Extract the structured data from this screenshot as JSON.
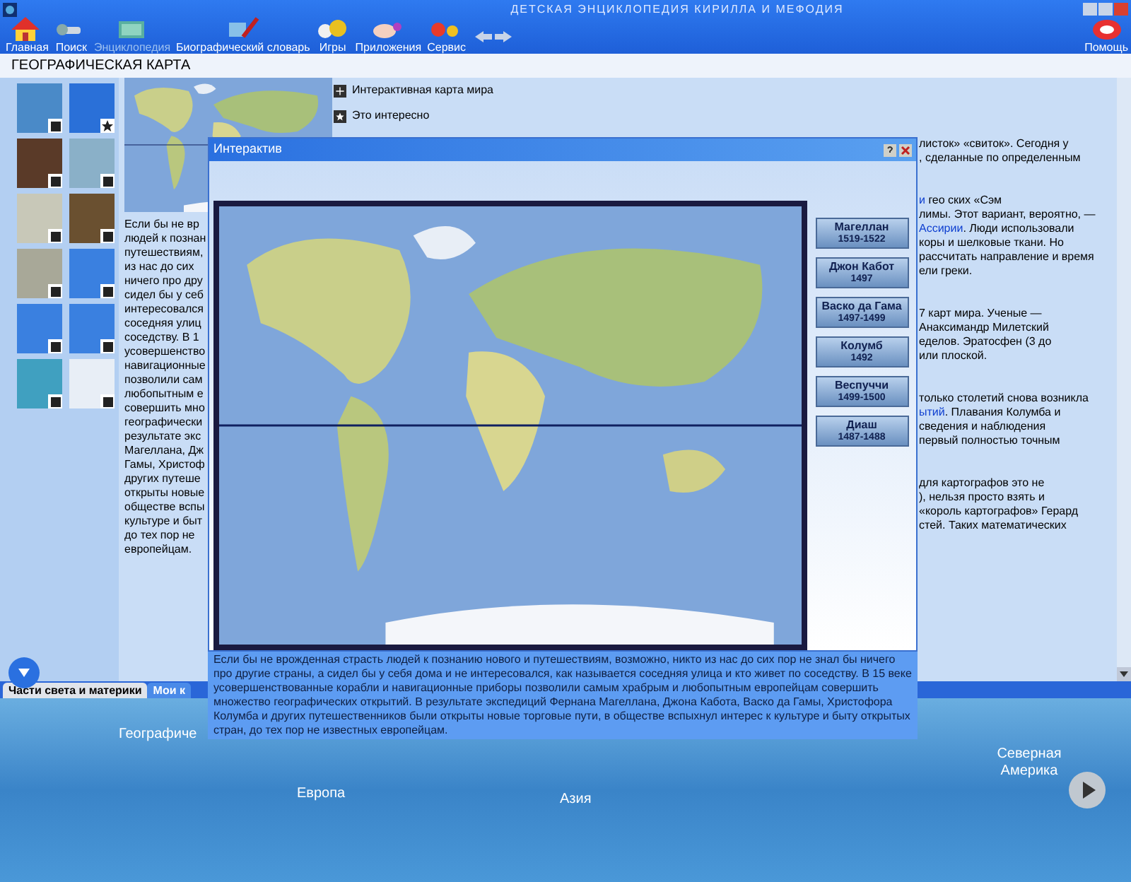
{
  "window": {
    "title": "ДЕТСКАЯ ЭНЦИКЛОПЕДИЯ КИРИЛЛА И МЕФОДИЯ"
  },
  "nav": [
    {
      "label": "Главная",
      "selected": false,
      "kind": "home"
    },
    {
      "label": "Поиск",
      "selected": false,
      "kind": "search"
    },
    {
      "label": "Энциклопедия",
      "selected": true,
      "kind": "book"
    },
    {
      "label": "Биографический словарь",
      "selected": false,
      "kind": "pen"
    },
    {
      "label": "Игры",
      "selected": false,
      "kind": "game"
    },
    {
      "label": "Приложения",
      "selected": false,
      "kind": "app"
    },
    {
      "label": "Сервис",
      "selected": false,
      "kind": "service"
    }
  ],
  "help": {
    "label": "Помощь"
  },
  "section_title": "ГЕОГРАФИЧЕСКАЯ КАРТА",
  "thumbnails": [
    {
      "kind": "frame"
    },
    {
      "kind": "star"
    },
    {
      "kind": "frame"
    },
    {
      "kind": "frame"
    },
    {
      "kind": "frame"
    },
    {
      "kind": "frame"
    },
    {
      "kind": "frame"
    },
    {
      "kind": "frame"
    },
    {
      "kind": "frame"
    },
    {
      "kind": "frame"
    },
    {
      "kind": "frame"
    },
    {
      "kind": "frame"
    }
  ],
  "links": [
    {
      "label": "Интерактивная карта мира",
      "kind": "map"
    },
    {
      "label": "Это интересно",
      "kind": "star"
    }
  ],
  "article_left": [
    "Если бы не вр",
    "людей к познан",
    "путешествиям,",
    "из нас до сих",
    "ничего про дру",
    "сидел бы у себ",
    "интересовался",
    "соседняя улиц",
    "соседству. В 1",
    "усовершенство",
    "навигационные",
    "позволили сам",
    "любопытным е",
    "совершить мно",
    "географически",
    "результате экс",
    "Магеллана, Дж",
    "Гамы, Христоф",
    "других путеше",
    "открыты новые",
    "обществе вспы",
    "культуре и быт",
    "до тех пор не",
    "европейцам."
  ],
  "article_right": [
    {
      "lines": [
        [
          {
            "text": "листок» «свиток». Сегодня у",
            "link": false
          }
        ],
        [
          {
            "text": ", сделанные по определенным",
            "link": false
          }
        ]
      ]
    },
    {
      "lines": [
        [
          {
            "text": "и",
            "link": true
          },
          {
            "text": " гео ских «Сэм",
            "link": false
          }
        ],
        [
          {
            "text": "лимы. Этот вариант, вероятно, —",
            "link": false
          }
        ],
        [
          {
            "text": "Ассирии",
            "link": true
          },
          {
            "text": ". Люди использовали",
            "link": false
          }
        ],
        [
          {
            "text": "коры и шелковые ткани. Но",
            "link": false
          }
        ],
        [
          {
            "text": "рассчитать направление и время",
            "link": false
          }
        ],
        [
          {
            "text": "ели греки.",
            "link": false
          }
        ]
      ]
    },
    {
      "lines": [
        [
          {
            "text": "7 карт мира. Ученые —",
            "link": false
          }
        ],
        [
          {
            "text": "Анаксимандр Милетский",
            "link": false
          }
        ],
        [
          {
            "text": "еделов. Эратосфен (3 до",
            "link": false
          }
        ],
        [
          {
            "text": "или плоской.",
            "link": false
          }
        ]
      ]
    },
    {
      "lines": [
        [
          {
            "text": "только столетий снова возникла",
            "link": false
          }
        ],
        [
          {
            "text": "ытий",
            "link": true
          },
          {
            "text": ". Плавания Колумба и",
            "link": false
          }
        ],
        [
          {
            "text": "сведения и наблюдения",
            "link": false
          }
        ],
        [
          {
            "text": "первый полностью точным",
            "link": false
          }
        ]
      ]
    },
    {
      "lines": [
        [
          {
            "text": "для картографов это не",
            "link": false
          }
        ],
        [
          {
            "text": "), нельзя просто взять и",
            "link": false
          }
        ],
        [
          {
            "text": "«король картографов» Герард",
            "link": false
          }
        ],
        [
          {
            "text": "стей. Таких математических",
            "link": false
          }
        ]
      ]
    }
  ],
  "popup": {
    "title": "Интерактив",
    "explorers": [
      {
        "name": "Магеллан",
        "years": "1519-1522"
      },
      {
        "name": "Джон Кабот",
        "years": "1497"
      },
      {
        "name": "Васко да Гама",
        "years": "1497-1499"
      },
      {
        "name": "Колумб",
        "years": "1492"
      },
      {
        "name": "Веспуччи",
        "years": "1499-1500"
      },
      {
        "name": "Диаш",
        "years": "1487-1488"
      }
    ],
    "caption": "Если бы не врожденная страсть людей к познанию нового и путешествиям, возможно, никто из нас до сих пор не знал бы ничего про другие страны, а сидел бы у себя дома и не интересовался, как называется соседняя улица и кто живет по соседству. В 15 веке усовершенствованные корабли и навигационные приборы позволили самым храбрым и любопытным европейцам совершить множество географических открытий. В результате экспедиций Фернана Магеллана, Джона Кабота, Васко да Гамы, Христофора Колумба и других путешественников были открыты новые торговые пути, в обществе вспыхнул интерес к культуре и быту открытых стран, до тех пор не известных европейцам."
  },
  "bottom_tabs": [
    {
      "label": "Части света и материки",
      "selected": true
    },
    {
      "label": "Мои к",
      "selected": false
    }
  ],
  "banner_labels": [
    {
      "label": "Географиче",
      "kind": "left"
    },
    {
      "label": "Европа",
      "kind": "europe"
    },
    {
      "label": "Азия",
      "kind": "asia"
    },
    {
      "label": "Северная Америка",
      "kind": "america"
    }
  ]
}
